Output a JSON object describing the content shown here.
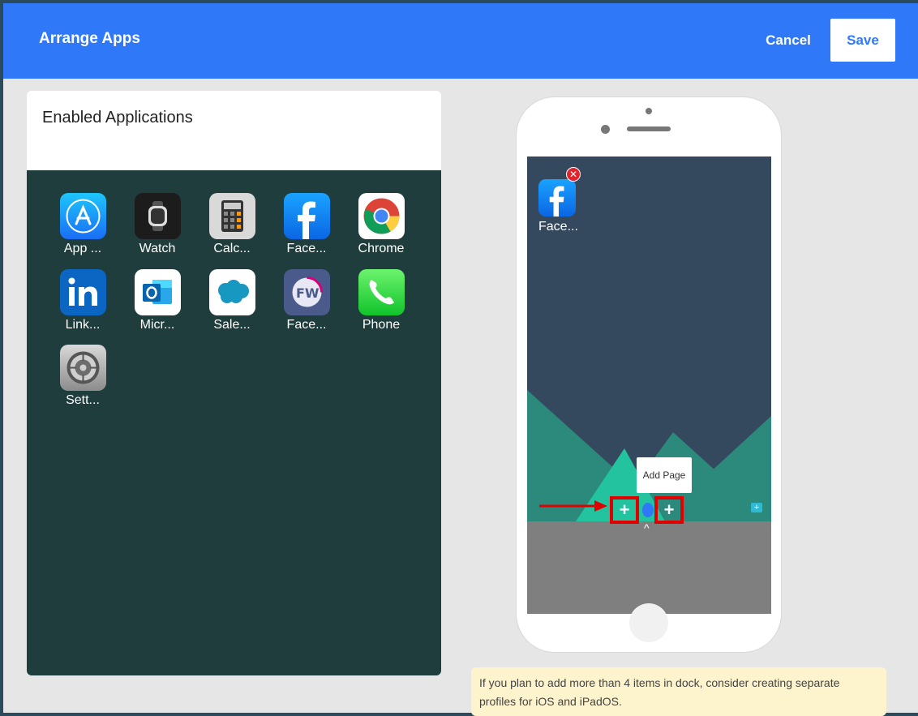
{
  "header": {
    "title": "Arrange Apps",
    "cancel_label": "Cancel",
    "save_label": "Save",
    "bg_color": "#2f78f8"
  },
  "enabled_panel": {
    "title": "Enabled Applications",
    "apps": [
      {
        "label": "App ...",
        "icon": "app-store-icon"
      },
      {
        "label": "Watch",
        "icon": "watch-icon"
      },
      {
        "label": "Calc...",
        "icon": "calculator-icon"
      },
      {
        "label": "Face...",
        "icon": "facebook-icon"
      },
      {
        "label": "Chrome",
        "icon": "chrome-icon"
      },
      {
        "label": "Link...",
        "icon": "linkedin-icon"
      },
      {
        "label": "Micr...",
        "icon": "outlook-icon"
      },
      {
        "label": "Sale...",
        "icon": "salesforce-icon"
      },
      {
        "label": "Face...",
        "icon": "facebook-workplace-icon"
      },
      {
        "label": "Phone",
        "icon": "phone-icon"
      },
      {
        "label": "Sett...",
        "icon": "settings-icon"
      }
    ]
  },
  "phone_preview": {
    "home_apps": [
      {
        "label": "Face...",
        "icon": "facebook-icon"
      }
    ],
    "tooltip": "Add Page",
    "add_symbol": "+"
  },
  "info_note": "If you plan to add more than 4 items in dock, consider creating separate profiles for iOS and iPadOS."
}
